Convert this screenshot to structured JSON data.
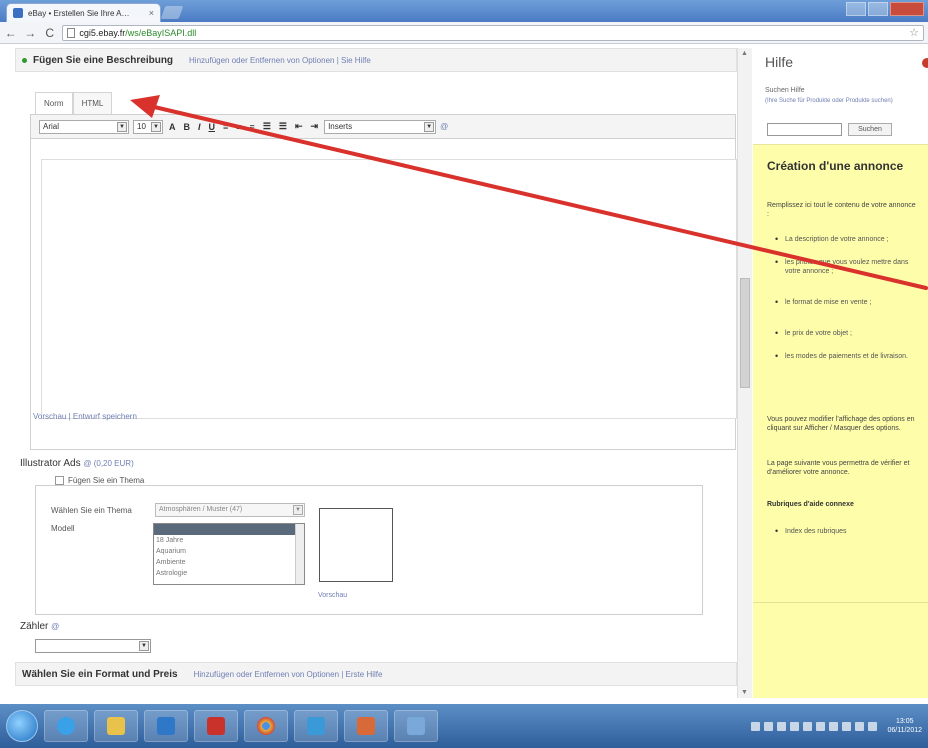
{
  "browser": {
    "tab_title": "eBay • Erstellen Sie Ihre A…",
    "tab_close": "×",
    "url_host": "cgi5.ebay.fr",
    "url_path": "/ws/eBayISAPI.dll",
    "back": "←",
    "forward": "→",
    "reload": "C",
    "star": "☆"
  },
  "description_section": {
    "title": "Fügen Sie eine Beschreibung",
    "links": "Hinzufügen oder Entfernen von Optionen | Sie Hilfe",
    "tabs": [
      "Norm",
      "HTML"
    ]
  },
  "editor_toolbar": {
    "font": "Arial",
    "size": "10",
    "inserts": "Inserts",
    "help": "@"
  },
  "editor_links": "Vorschau | Entwurf speichern",
  "ads": {
    "title": "Illustrator Ads",
    "price": "@ (0,20 EUR)",
    "legend": "Fügen Sie ein Thema",
    "theme_label": "Wählen Sie ein Thema",
    "theme_value": "Atmosphären / Muster (47)",
    "model_label": "Modell",
    "model_options": [
      "",
      "18 Jahre",
      "Aquarium",
      "Ambiente",
      "Astrologie"
    ],
    "preview_link": "Vorschau"
  },
  "counter": {
    "title": "Zähler",
    "help": "@"
  },
  "format_section": {
    "title": "Wählen Sie ein Format und Preis",
    "links": "Hinzufügen oder Entfernen von Optionen | Erste Hilfe"
  },
  "help": {
    "title": "Hilfe",
    "search_label": "Suchen Hilfe",
    "search_hint": "(Ihre Suche für Produkte oder Produkte suchen)",
    "search_button": "Suchen",
    "heading": "Création d'une annonce",
    "intro": "Remplissez ici tout le contenu de votre annonce :",
    "items": [
      "La description de votre annonce ;",
      "les photos que vous voulez mettre dans votre annonce ;",
      "le format de mise en vente ;",
      "le prix de votre objet ;",
      "les modes de paiements et de livraison."
    ],
    "options_text": "Vous pouvez modifier l'affichage des options en cliquant sur Afficher / Masquer des options.",
    "next_text": "La page suivante vous permettra de vérifier et d'améliorer votre annonce.",
    "related_title": "Rubriques d'aide connexe",
    "related_items": [
      "Index des rubriques"
    ]
  },
  "taskbar": {
    "clock_time": "13:05",
    "clock_date": "06/11/2012"
  },
  "colors": {
    "help_bg": "#fdfdaa",
    "link": "#6f7fb3",
    "arrow": "#d9312b"
  }
}
